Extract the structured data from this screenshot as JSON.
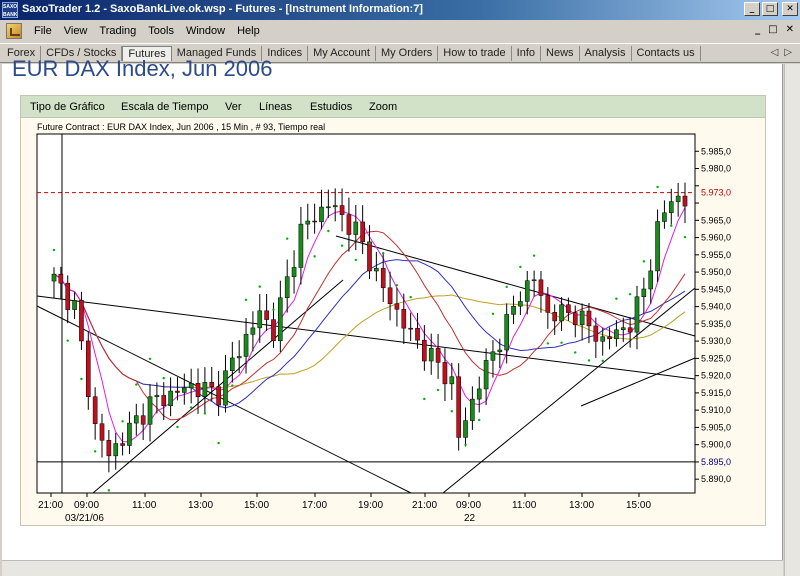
{
  "window": {
    "icon_text": "SAXO BANK",
    "title": "SaxoTrader 1.2 - SaxoBankLive.ok.wsp - Futures - [Instrument Information:7]",
    "buttons": [
      "_",
      "□",
      "✕"
    ]
  },
  "menubar": {
    "items": [
      "File",
      "View",
      "Trading",
      "Tools",
      "Window",
      "Help"
    ],
    "child_buttons": [
      "_",
      "□",
      "✕"
    ]
  },
  "tabs": {
    "items": [
      "Forex",
      "CFDs / Stocks",
      "Futures",
      "Managed Funds",
      "Indices",
      "My Account",
      "My Orders",
      "How to trade",
      "Info",
      "News",
      "Analysis",
      "Contacts us"
    ],
    "active": "Futures",
    "arrows": [
      "◁",
      "▷"
    ]
  },
  "instrument": {
    "title": "EUR DAX Index, Jun 2006"
  },
  "chart_toolbar": {
    "items": [
      "Tipo de Gráfico",
      "Escala de Tiempo",
      "Ver",
      "Líneas",
      "Estudios",
      "Zoom"
    ]
  },
  "chart_info": "Future Contract : EUR DAX Index, Jun 2006 , 15 Min , # 93, Tiempo real",
  "chart_data": {
    "type": "candlestick",
    "title": "",
    "y_ticks": [
      5985,
      5980,
      5975,
      5970,
      5965,
      5960,
      5955,
      5950,
      5945,
      5940,
      5935,
      5930,
      5925,
      5920,
      5915,
      5910,
      5905,
      5900,
      5895,
      5890
    ],
    "y_tick_labels": [
      "5.985,0",
      "5.980,0",
      "",
      "",
      "5.965,0",
      "5.960,0",
      "5.955,0",
      "5.950,0",
      "5.945,0",
      "5.940,0",
      "5.935,0",
      "5.930,0",
      "5.925,0",
      "5.920,0",
      "5.915,0",
      "5.910,0",
      "5.905,0",
      "5.900,0",
      "",
      "5.890,0"
    ],
    "ylim": [
      5886,
      5990
    ],
    "price_line": {
      "value": 5973,
      "label": "5.973,0",
      "color": "#cc0000"
    },
    "support_line": {
      "value": 5895,
      "label": "5.895,0",
      "color": "#000080"
    },
    "x_ticks": [
      "21:00",
      "09:00",
      "11:00",
      "13:00",
      "15:00",
      "17:00",
      "19:00",
      "21:00",
      "09:00",
      "11:00",
      "13:00",
      "15:00"
    ],
    "x_date_labels": [
      {
        "text": "03/21/06",
        "at": 1
      },
      {
        "text": "22",
        "at": 8
      }
    ],
    "candle_count": 93,
    "colors": {
      "up": "#1a8a1a",
      "down": "#c01020",
      "sma_fast": "#e020e0",
      "sma_mid": "#c03030",
      "sma_slow": "#3030c0",
      "sma_long": "#c0a020",
      "sar": "#00b000"
    }
  }
}
